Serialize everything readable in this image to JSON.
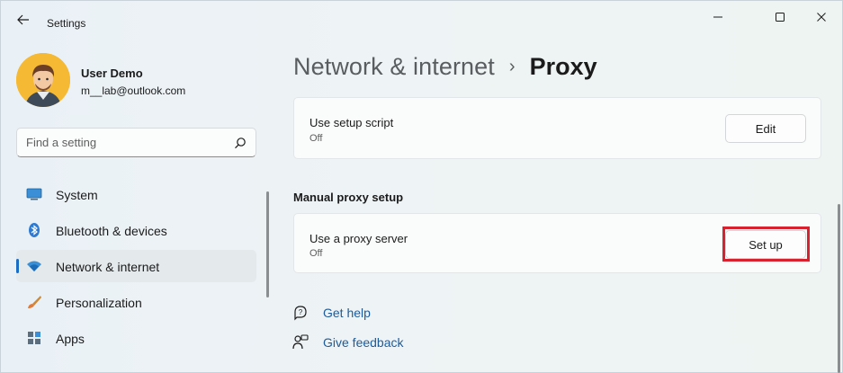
{
  "window": {
    "title": "Settings"
  },
  "user": {
    "name": "User Demo",
    "email": "m__lab@outlook.com"
  },
  "search": {
    "placeholder": "Find a setting"
  },
  "sidebar": {
    "items": [
      {
        "label": "System",
        "icon": "system-icon"
      },
      {
        "label": "Bluetooth & devices",
        "icon": "bluetooth-icon"
      },
      {
        "label": "Network & internet",
        "icon": "wifi-icon",
        "active": true
      },
      {
        "label": "Personalization",
        "icon": "brush-icon"
      },
      {
        "label": "Apps",
        "icon": "apps-icon"
      }
    ]
  },
  "breadcrumb": {
    "parent": "Network & internet",
    "separator": "›",
    "current": "Proxy"
  },
  "setup_script_card": {
    "title": "Use setup script",
    "status": "Off",
    "button": "Edit"
  },
  "manual_section": {
    "header": "Manual proxy setup"
  },
  "proxy_server_card": {
    "title": "Use a proxy server",
    "status": "Off",
    "button": "Set up"
  },
  "links": {
    "help": "Get help",
    "feedback": "Give feedback"
  },
  "colors": {
    "accent": "#1b6dc4",
    "highlight": "#d7232f",
    "link": "#1d5b9b"
  }
}
